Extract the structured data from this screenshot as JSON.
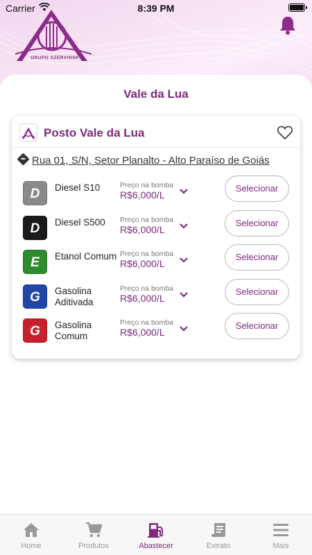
{
  "status_bar": {
    "carrier": "Carrier",
    "time": "8:39 PM"
  },
  "brand": {
    "logo_text": "GRUPO SZERVINSK"
  },
  "page": {
    "title": "Vale da Lua"
  },
  "station": {
    "name": "Posto Vale da Lua",
    "address": "Rua 01, S/N, Setor Planalto - Alto Paraíso de Goiás"
  },
  "fuels": [
    {
      "letter": "D",
      "name": "Diesel S10",
      "price_label": "Preço na bomba",
      "price": "R$6,000/L",
      "button": "Selecionar",
      "color": "#8a8a8a"
    },
    {
      "letter": "D",
      "name": "Diesel S500",
      "price_label": "Preço na bomba",
      "price": "R$6,000/L",
      "button": "Selecionar",
      "color": "#1a1a1a"
    },
    {
      "letter": "E",
      "name": "Etanol Comum",
      "price_label": "Preço na bomba",
      "price": "R$6,000/L",
      "button": "Selecionar",
      "color": "#2e8b2e"
    },
    {
      "letter": "G",
      "name": "Gasolina Aditivada",
      "price_label": "Preço na bomba",
      "price": "R$6,000/L",
      "button": "Selecionar",
      "color": "#1f46a8"
    },
    {
      "letter": "G",
      "name": "Gasolina Comum",
      "price_label": "Preço na bomba",
      "price": "R$6,000/L",
      "button": "Selecionar",
      "color": "#c8202a"
    }
  ],
  "tabs": [
    {
      "label": "Home",
      "icon": "home-icon"
    },
    {
      "label": "Produtos",
      "icon": "cart-icon"
    },
    {
      "label": "Abastecer",
      "icon": "fuel-pump-icon",
      "active": true
    },
    {
      "label": "Extrato",
      "icon": "receipt-icon"
    },
    {
      "label": "Mais",
      "icon": "menu-icon"
    }
  ],
  "colors": {
    "accent": "#7b2a7c",
    "inactive": "#999999"
  }
}
